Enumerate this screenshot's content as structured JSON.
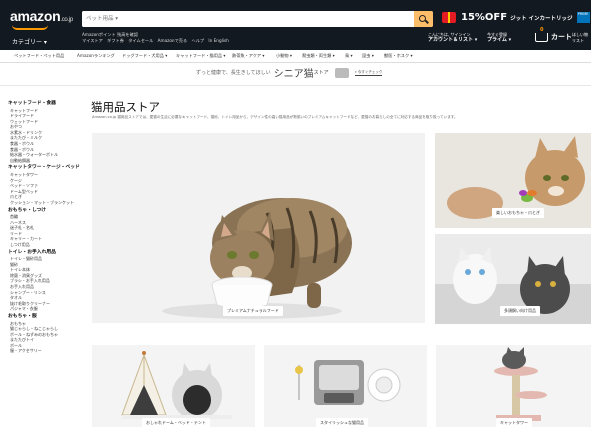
{
  "header": {
    "logo_text": "amazon",
    "logo_suffix": ".co.jp",
    "category_menu": "カテゴリー ▾",
    "search_placeholder": "ペット用品 ▾",
    "under_links": [
      "Amazonポイント 残高を確認",
      "マイストア",
      "ギフト券",
      "タイムセール",
      "Amazonで売る",
      "ヘルプ",
      "In English"
    ],
    "promo_pct": "15%OFF",
    "promo_text": "ジット インカートリッジ",
    "promo_icon_text": "PRIME",
    "account_small": "こんにちは, サインイン",
    "account_label": "アカウント＆リスト ▾",
    "orders_small": "返品もこちら",
    "orders_label": "注文履歴",
    "prime_small": "今すぐ登録",
    "prime_label": "プライム ▾",
    "cart_label": "カート",
    "cart_count": "0",
    "right_small": "ほしい物",
    "right_label": "リスト"
  },
  "nav_links": [
    "ペットフード・ペット用品",
    "Amazonランキング",
    "ドッグフード・犬用品 ▾",
    "キャットフード・猫用品 ▾",
    "熱帯魚・アクア ▾",
    "小動物 ▾",
    "爬虫類・両生類 ▾",
    "鳥 ▾",
    "昆虫 ▾",
    "獣医・ホスク ▾"
  ],
  "banner": {
    "pre": "ずっと健康で、長生きしてほしい",
    "main": "シニア猫",
    "suffix": "ストア",
    "link": "» 今すぐチェック"
  },
  "sidebar": [
    {
      "heading": "キャットフード・食器",
      "items": [
        "キャットフード",
        "ドライフード",
        "ウェットフード",
        "おやつ",
        "水素水・ドリンク",
        "またたび・ミルク",
        "食器・ボウル",
        "食器・ボウル",
        "給水器・ウォーターボトル",
        "自動給餌器"
      ]
    },
    {
      "heading": "キャットタワー・ケージ・ベッド",
      "items": [
        "キャットタワー",
        "ケージ",
        "ベッド・ソファ",
        "ドーム型ベッド",
        "爪とぎ",
        "クッション・マット・ブランケット"
      ]
    },
    {
      "heading": "おもちゃ・しつけ",
      "items": [
        "首輪",
        "ハーネス",
        "迷子札・名札",
        "リード",
        "キャリー・カート",
        "しつけ用品"
      ]
    },
    {
      "heading": "トイレ・お手入れ用品",
      "items": [
        "トイレ・猫砂用品",
        "猫砂",
        "トイレ本体",
        "除菌・消臭グッズ",
        "ブラシ・お手入れ用品",
        "お手入れ用品",
        "シャンプー・リンス",
        "タオル",
        "抜け毛取りクリーナー",
        "パジャマ・衣服"
      ]
    },
    {
      "heading": "おもちゃ・服",
      "items": [
        "おもちゃ",
        "猫じゃらし・ねこじゃらし",
        "ボール・ねずみのおもちゃ",
        "またたびトイ",
        "ボール",
        "服・アクセサリー"
      ]
    }
  ],
  "main": {
    "title": "猫用品ストア",
    "description": "Amazon.co.jp 猫用品ストアでは、愛猫の生活に必要なキャットフード、猫砂、トイレ用品から、デザイン性の高い猫用品が勢揃いのプレミアムキャットフードなど、愛猫のお暮らしの全てに対応する商品を取り扱っています。",
    "tiles": [
      {
        "label": "プレミアムナチュラルフード"
      },
      {
        "label": "楽しいおもちゃ・爪とぎ"
      },
      {
        "label": "多頭飼い向け用品"
      },
      {
        "label": "おしゃれドーム・ベッド・テント"
      },
      {
        "label": "スタイリッシュな猫用品"
      },
      {
        "label": "キャットタワー"
      }
    ]
  },
  "colors": {
    "header_bg": "#131921",
    "accent": "#ff9900",
    "search_button": "#febd69"
  }
}
